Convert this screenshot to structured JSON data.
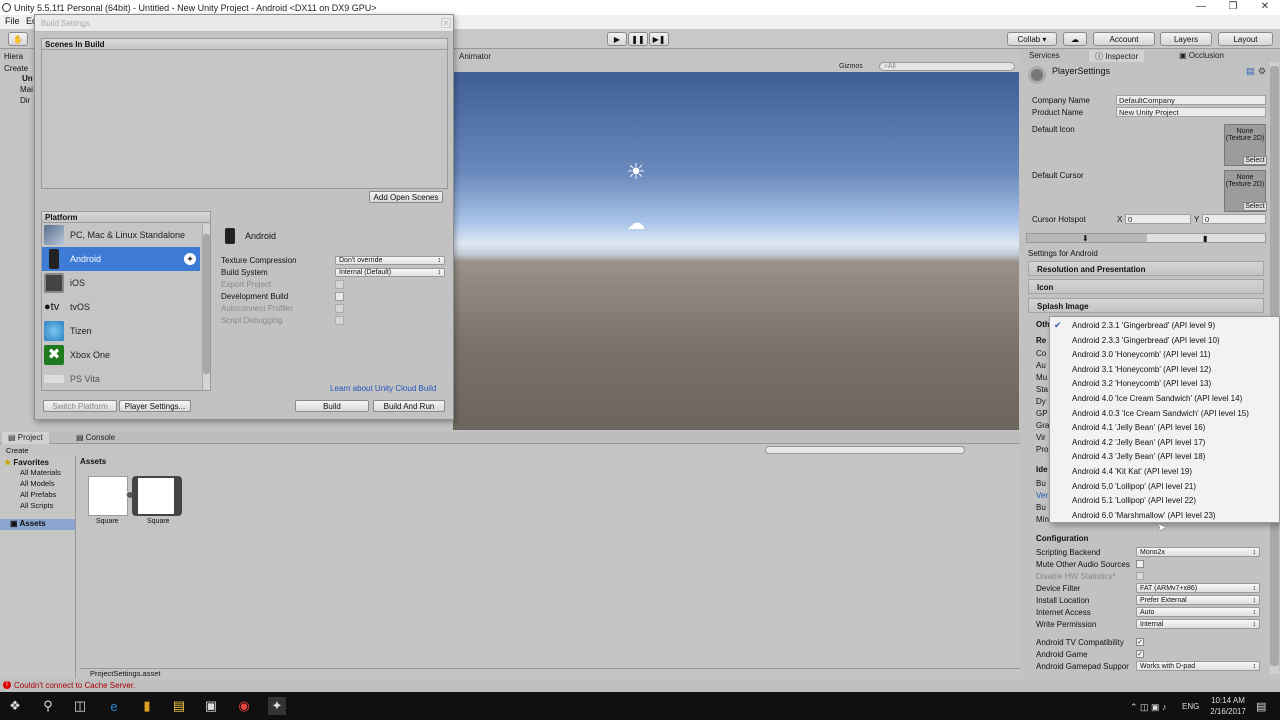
{
  "window": {
    "title": "Unity 5.5.1f1 Personal (64bit) - Untitled - New Unity Project - Android <DX11 on DX9 GPU>"
  },
  "menubar": {
    "items": [
      "File",
      "Ec"
    ]
  },
  "toolbar": {
    "collab": "Collab ▾",
    "account": "Account",
    "layers": "Layers",
    "layout": "Layout"
  },
  "hierarchy": {
    "tab": "Hiera",
    "create": "Create",
    "items": [
      "Un",
      "Mai",
      "Dir"
    ]
  },
  "scene": {
    "animator_tab": "Animator",
    "gizmos": "Gizmos",
    "search_placeholder": "⌕All"
  },
  "build_settings": {
    "title": "Build Settings",
    "scenes_header": "Scenes In Build",
    "add_open_scenes": "Add Open Scenes",
    "platform_header": "Platform",
    "platforms": [
      "PC, Mac & Linux Standalone",
      "Android",
      "iOS",
      "tvOS",
      "Tizen",
      "Xbox One",
      "PS Vita"
    ],
    "selected_platform": "Android",
    "tvos_prefix": "tv",
    "settings": [
      {
        "label": "Texture Compression",
        "value": "Don't override"
      },
      {
        "label": "Build System",
        "value": "Internal (Default)"
      }
    ],
    "checkboxes": [
      "Export Project",
      "Development Build",
      "Autoconnect Profiler",
      "Script Debugging"
    ],
    "cloud_link": "Learn about Unity Cloud Build",
    "switch_platform": "Switch Platform",
    "player_settings": "Player Settings...",
    "build": "Build",
    "build_and_run": "Build And Run"
  },
  "inspector": {
    "tabs": [
      "Services",
      "Inspector",
      "Occlusion"
    ],
    "title": "PlayerSettings",
    "company_label": "Company Name",
    "company_value": "DefaultCompany",
    "product_label": "Product Name",
    "product_value": "New Unity Project",
    "default_icon": "Default Icon",
    "default_cursor": "Default Cursor",
    "tex_none": "None (Texture 2D)",
    "select": "Select",
    "hotspot_label": "Cursor Hotspot",
    "hotspot_x": "X",
    "hotspot_x_val": "0",
    "hotspot_y": "Y",
    "hotspot_y_val": "0",
    "settings_for": "Settings for Android",
    "sections": [
      "Resolution and Presentation",
      "Icon",
      "Splash Image"
    ],
    "hidden_labels": [
      "Oth",
      "Re",
      "Co",
      "Au",
      "Mu",
      "Sta",
      "Dy",
      "GP",
      "Gra",
      "Vir",
      "Pro",
      "Ide",
      "Bu",
      "Ver",
      "Bu",
      "Min"
    ],
    "config_header": "Configuration",
    "config_rows": [
      {
        "label": "Scripting Backend",
        "value": "Mono2x"
      },
      {
        "label": "Mute Other Audio Sources",
        "value": ""
      },
      {
        "label": "Disable HW Statistics*",
        "value": ""
      },
      {
        "label": "Device Filter",
        "value": "FAT (ARMv7+x86)"
      },
      {
        "label": "Install Location",
        "value": "Prefer External"
      },
      {
        "label": "Internet Access",
        "value": "Auto"
      },
      {
        "label": "Write Permission",
        "value": "Internal"
      },
      {
        "label": "Android TV Compatibility",
        "value": ""
      },
      {
        "label": "Android Game",
        "value": ""
      },
      {
        "label": "Android Gamepad Suppor",
        "value": "Works with D-pad"
      }
    ]
  },
  "api_popup": {
    "selected_index": 0,
    "items": [
      "Android 2.3.1 'Gingerbread' (API level 9)",
      "Android 2.3.3 'Gingerbread' (API level 10)",
      "Android 3.0 'Honeycomb' (API level 11)",
      "Android 3.1 'Honeycomb' (API level 12)",
      "Android 3.2 'Honeycomb' (API level 13)",
      "Android 4.0 'Ice Cream Sandwich' (API level 14)",
      "Android 4.0.3 'Ice Cream Sandwich' (API level 15)",
      "Android 4.1 'Jelly Bean' (API level 16)",
      "Android 4.2 'Jelly Bean' (API level 17)",
      "Android 4.3 'Jelly Bean' (API level 18)",
      "Android 4.4 'Kit Kat' (API level 19)",
      "Android 5.0 'Lollipop' (API level 21)",
      "Android 5.1 'Lollipop' (API level 22)",
      "Android 6.0 'Marshmallow' (API level 23)"
    ]
  },
  "project": {
    "tabs": [
      "Project",
      "Console"
    ],
    "create": "Create",
    "favorites": "Favorites",
    "fav_items": [
      "All Materials",
      "All Models",
      "All Prefabs",
      "All Scripts"
    ],
    "assets_folder": "Assets",
    "breadcrumb": "Assets",
    "asset_items": [
      "Square",
      "Square"
    ],
    "footer_file": "ProjectSettings.asset"
  },
  "status": {
    "message": "Couldn't connect to Cache Server."
  },
  "taskbar": {
    "lang": "ENG",
    "time": "10:14 AM",
    "date": "2/16/2017"
  }
}
